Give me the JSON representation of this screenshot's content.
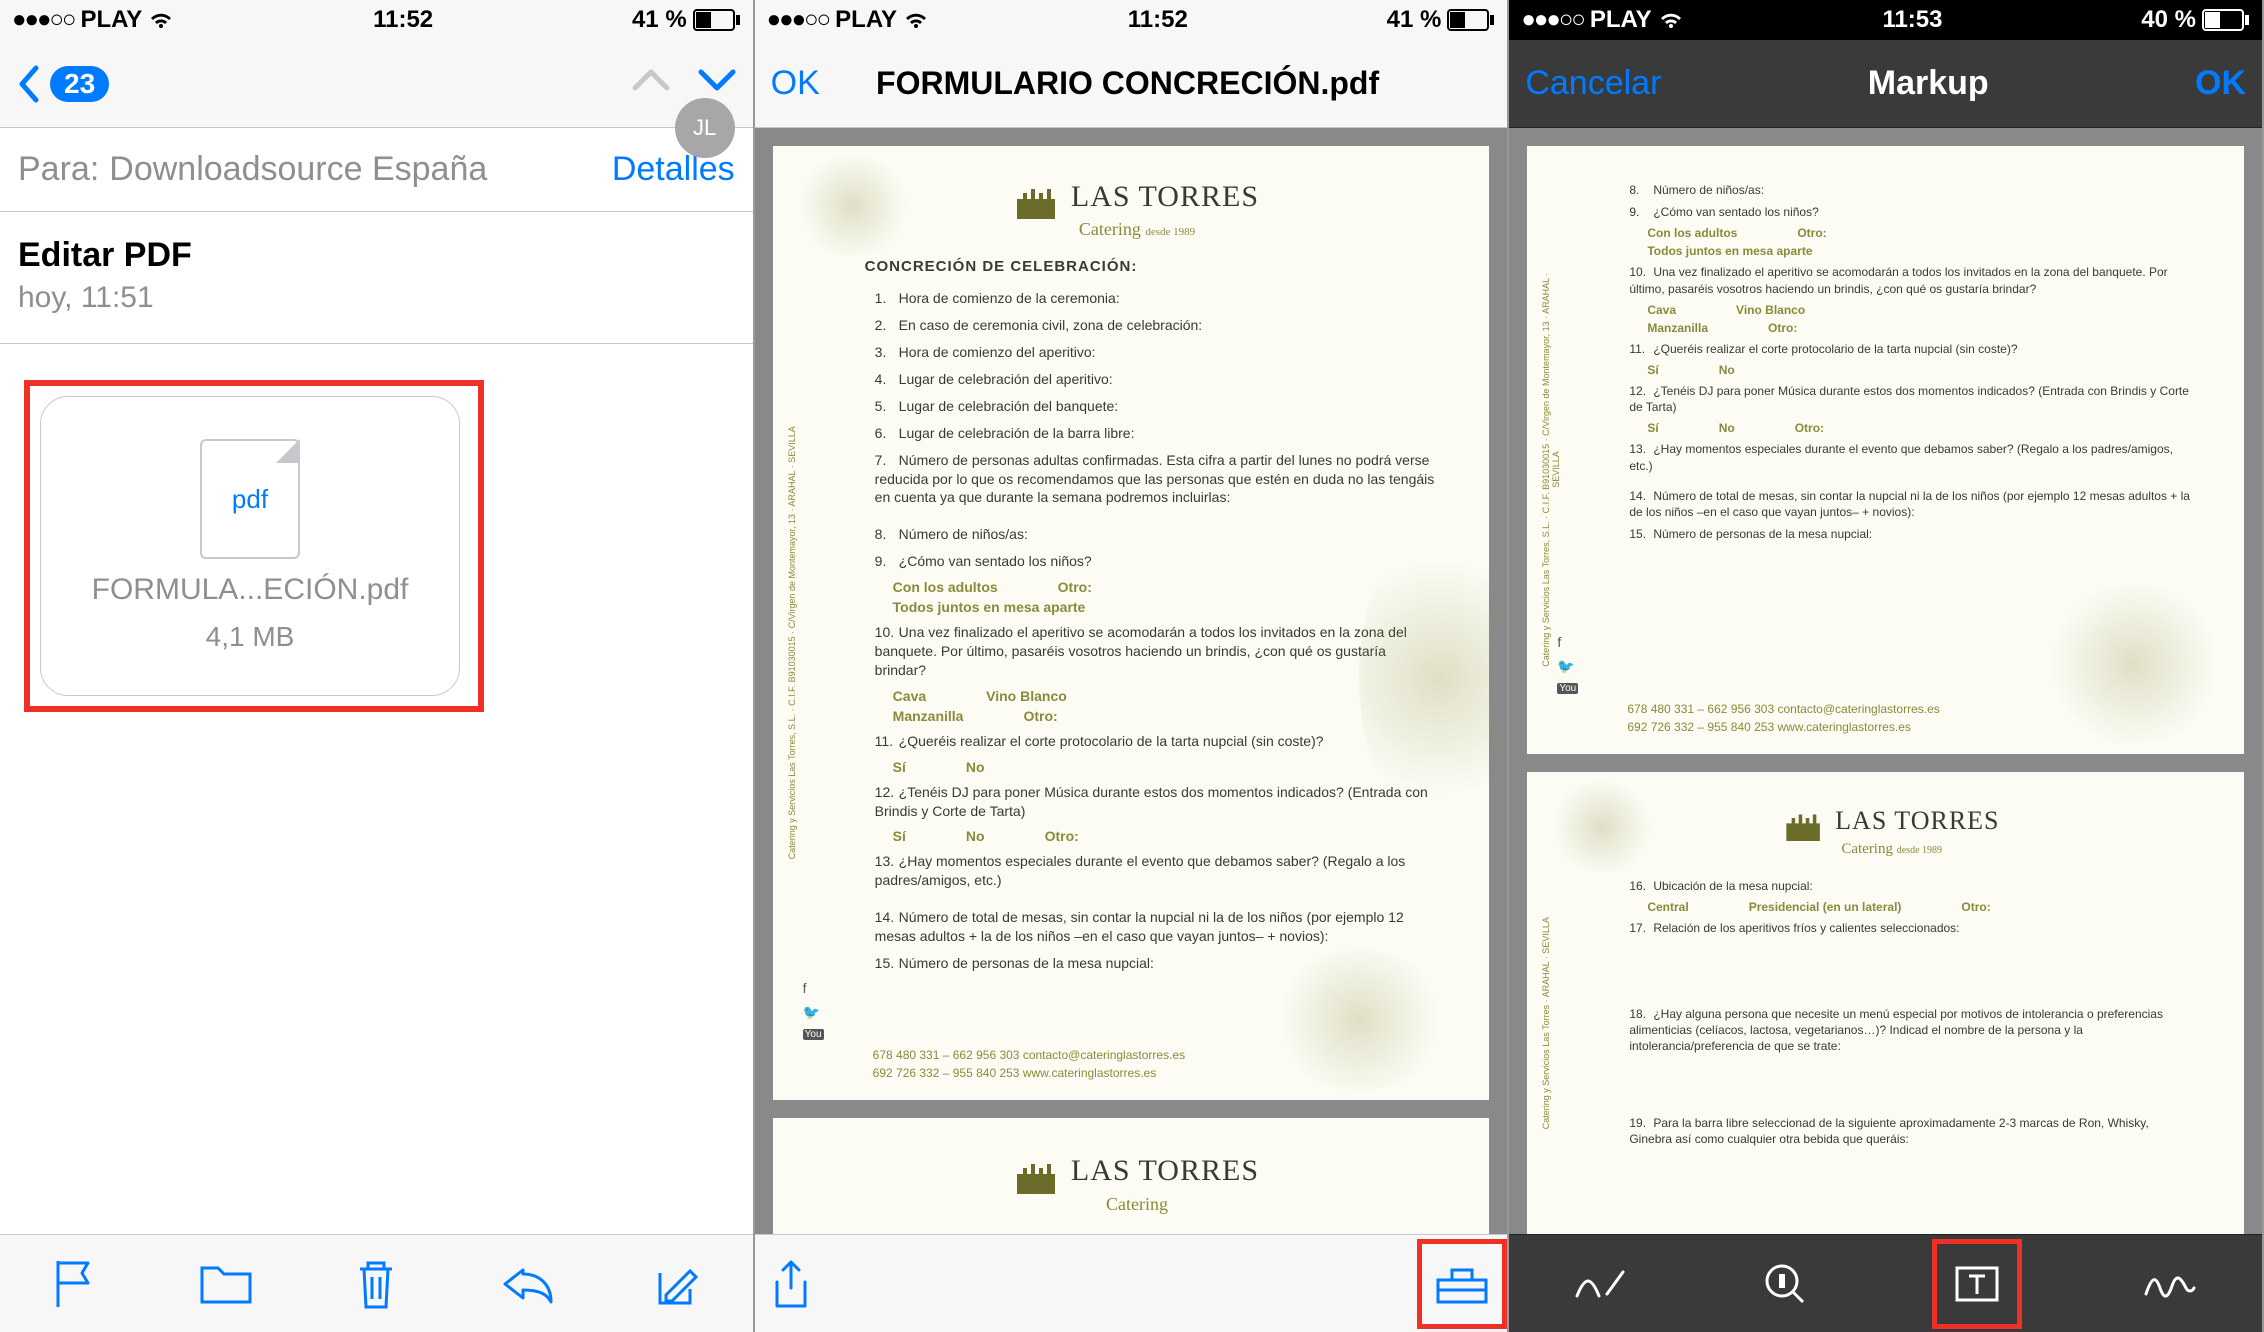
{
  "statusbars": {
    "s1": {
      "carrier": "PLAY",
      "time": "11:52",
      "battery": "41 %"
    },
    "s2": {
      "carrier": "PLAY",
      "time": "11:52",
      "battery": "41 %"
    },
    "s3": {
      "carrier": "PLAY",
      "time": "11:53",
      "battery": "40 %"
    }
  },
  "screen1": {
    "back_count": "23",
    "to_label": "Para:",
    "to_value": "Downloadsource España",
    "details": "Detalles",
    "subject": "Editar PDF",
    "date": "hoy, 11:51",
    "attachment": {
      "badge": "pdf",
      "name": "FORMULA...ECIÓN.pdf",
      "size": "4,1 MB"
    }
  },
  "screen2": {
    "ok": "OK",
    "title": "FORMULARIO CONCRECIÓN.pdf"
  },
  "screen3": {
    "cancel": "Cancelar",
    "title": "Markup",
    "ok": "OK"
  },
  "doc": {
    "brand": "LAS TORRES",
    "brand_sub": "Catering",
    "brand_since": "desde 1989",
    "heading": "CONCRECIÓN DE CELEBRACIÓN:",
    "items": [
      "Hora de comienzo de la ceremonia:",
      "En caso de ceremonia civil, zona de celebración:",
      "Hora de comienzo del aperitivo:",
      "Lugar de celebración del aperitivo:",
      "Lugar de celebración del banquete:",
      "Lugar de celebración de la barra libre:",
      "Número de personas adultas confirmadas. Esta cifra a partir del lunes no podrá verse reducida por lo que os recomendamos que las personas que estén en duda no las tengáis en cuenta ya que durante la semana podremos incluirlas:"
    ],
    "q8": "Número de niños/as:",
    "q9": "¿Cómo van sentado los niños?",
    "q9o": [
      "Con los adultos",
      "Otro:",
      "Todos juntos en mesa aparte"
    ],
    "q10": "Una vez finalizado el aperitivo se acomodarán a todos los invitados en la zona del banquete. Por último, pasaréis vosotros haciendo un brindis, ¿con qué os gustaría brindar?",
    "q10o": [
      "Cava",
      "Vino Blanco",
      "Manzanilla",
      "Otro:"
    ],
    "q11": "¿Queréis realizar el corte protocolario de la tarta nupcial (sin coste)?",
    "q11o": [
      "Sí",
      "No"
    ],
    "q12": "¿Tenéis DJ para poner Música durante estos dos momentos indicados? (Entrada con Brindis y Corte de Tarta)",
    "q12o": [
      "Sí",
      "No",
      "Otro:"
    ],
    "q13": "¿Hay momentos especiales durante el evento que debamos saber? (Regalo a los padres/amigos, etc.)",
    "q14": "Número de total de mesas, sin contar la nupcial ni la de los niños (por ejemplo 12 mesas adultos + la de los niños –en el caso que vayan juntos– + novios):",
    "q15": "Número de personas de la mesa nupcial:",
    "q16": "Ubicación de la mesa nupcial:",
    "q16o": [
      "Central",
      "Presidencial (en un lateral)",
      "Otro:"
    ],
    "q17": "Relación de los aperitivos fríos y calientes seleccionados:",
    "q18": "¿Hay alguna persona que necesite un menú especial por motivos de intolerancia o preferencias alimenticias (celíacos, lactosa, vegetarianos…)? Indicad el nombre de la persona y la intolerancia/preferencia de que se trate:",
    "q19": "Para la barra libre seleccionad de la siguiente aproximadamente 2-3 marcas de Ron, Whisky, Ginebra así como cualquier otra bebida que queráis:",
    "footer_phone": "678 480 331 – 662 956 303     contacto@cateringlastorres.es",
    "footer_phone2": "692 726 332 – 955 840 253     www.cateringlastorres.es"
  }
}
